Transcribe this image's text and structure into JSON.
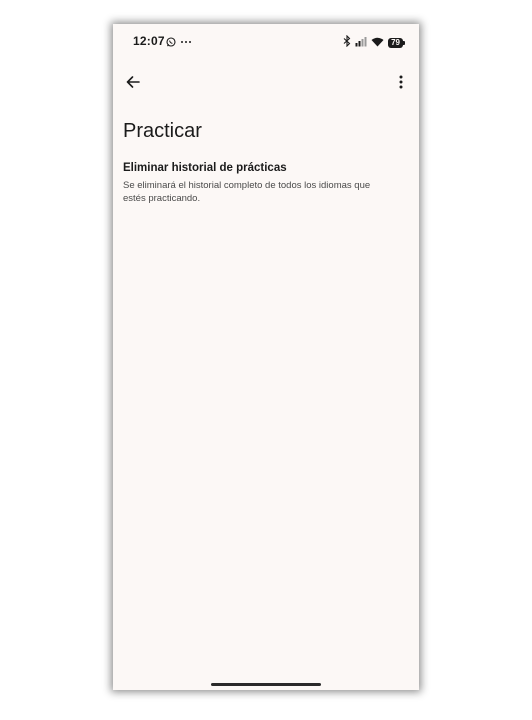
{
  "status_bar": {
    "time": "12:07",
    "notification_icons": [
      "whatsapp-icon",
      "more-notifications-icon"
    ],
    "system_icons": [
      "bluetooth-icon",
      "signal-icon",
      "wifi-icon"
    ],
    "battery": "79"
  },
  "app_bar": {
    "back_icon": "arrow-back-icon",
    "menu_icon": "more-vert-icon"
  },
  "page": {
    "title": "Practicar",
    "items": [
      {
        "title": "Eliminar historial de prácticas",
        "summary": "Se eliminará el historial completo de todos los idiomas que estés practicando."
      }
    ]
  }
}
